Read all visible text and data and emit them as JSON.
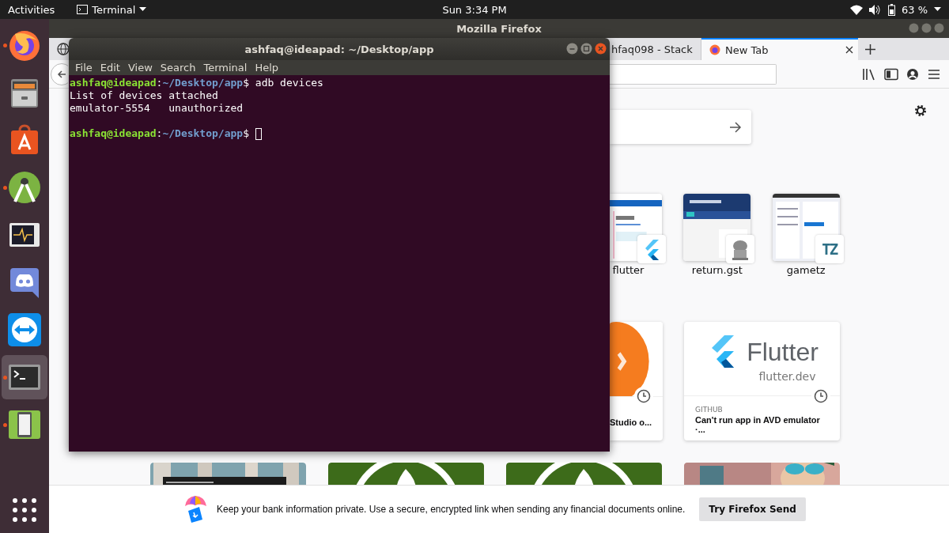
{
  "top_bar": {
    "activities": "Activities",
    "app_menu": "Terminal",
    "clock": "Sun 3:34 PM",
    "battery": "63 %"
  },
  "dock": {
    "items": [
      {
        "kind": "firefox",
        "running": true,
        "selected": false
      },
      {
        "kind": "files",
        "running": false,
        "selected": false
      },
      {
        "kind": "software",
        "running": false,
        "selected": false
      },
      {
        "kind": "android",
        "running": true,
        "selected": false
      },
      {
        "kind": "monitor",
        "running": false,
        "selected": false
      },
      {
        "kind": "discord",
        "running": false,
        "selected": false
      },
      {
        "kind": "teamviewer",
        "running": false,
        "selected": false
      },
      {
        "kind": "terminal",
        "running": true,
        "selected": true
      },
      {
        "kind": "phone",
        "running": true,
        "selected": false
      }
    ]
  },
  "firefox": {
    "title": "Mozilla Firefox",
    "tabs": [
      {
        "label": "hfaq098 - Stack",
        "selected": false,
        "favicon": false
      },
      {
        "label": "New Tab",
        "selected": true,
        "favicon": true
      }
    ],
    "top_sites": [
      {
        "label": "flutter",
        "kind": "flutter"
      },
      {
        "label": "return.gst",
        "kind": "gst"
      },
      {
        "label": "gametz",
        "kind": "tz",
        "icon_text": "TZ"
      }
    ],
    "highlights": [
      {
        "kind": "orange",
        "title": "Studio o..."
      },
      {
        "kind": "flutter",
        "source": "GITHUB",
        "title": "Can't run app in AVD emulator ·...",
        "preview_title": "Flutter",
        "preview_url": "flutter.dev"
      }
    ],
    "more": [
      {
        "kind": "birch"
      },
      {
        "kind": "green"
      },
      {
        "kind": "green"
      },
      {
        "kind": "comic"
      }
    ],
    "snippet": {
      "text": "Keep your bank information private. Use a secure, encrypted link when sending any financial documents online.",
      "button": "Try Firefox Send"
    }
  },
  "terminal": {
    "title": "ashfaq@ideapad: ~/Desktop/app",
    "menu": [
      "File",
      "Edit",
      "View",
      "Search",
      "Terminal",
      "Help"
    ],
    "blocks": [
      [
        {
          "segments": [
            {
              "kind": "user",
              "text": "ashfaq@ideapad"
            },
            {
              "kind": "plain",
              "text": ":"
            },
            {
              "kind": "path",
              "text": "~/Desktop/app"
            },
            {
              "kind": "plain",
              "text": "$ adb devices"
            }
          ],
          "cursor": false
        },
        {
          "segments": [
            {
              "kind": "output",
              "text": "List of devices attached"
            }
          ],
          "cursor": false
        },
        {
          "segments": [
            {
              "kind": "output",
              "text": "emulator-5554   unauthorized"
            }
          ],
          "cursor": false
        }
      ],
      [
        {
          "segments": [
            {
              "kind": "user",
              "text": "ashfaq@ideapad"
            },
            {
              "kind": "plain",
              "text": ":"
            },
            {
              "kind": "path",
              "text": "~/Desktop/app"
            },
            {
              "kind": "plain",
              "text": "$ "
            }
          ],
          "cursor": true
        }
      ]
    ]
  }
}
